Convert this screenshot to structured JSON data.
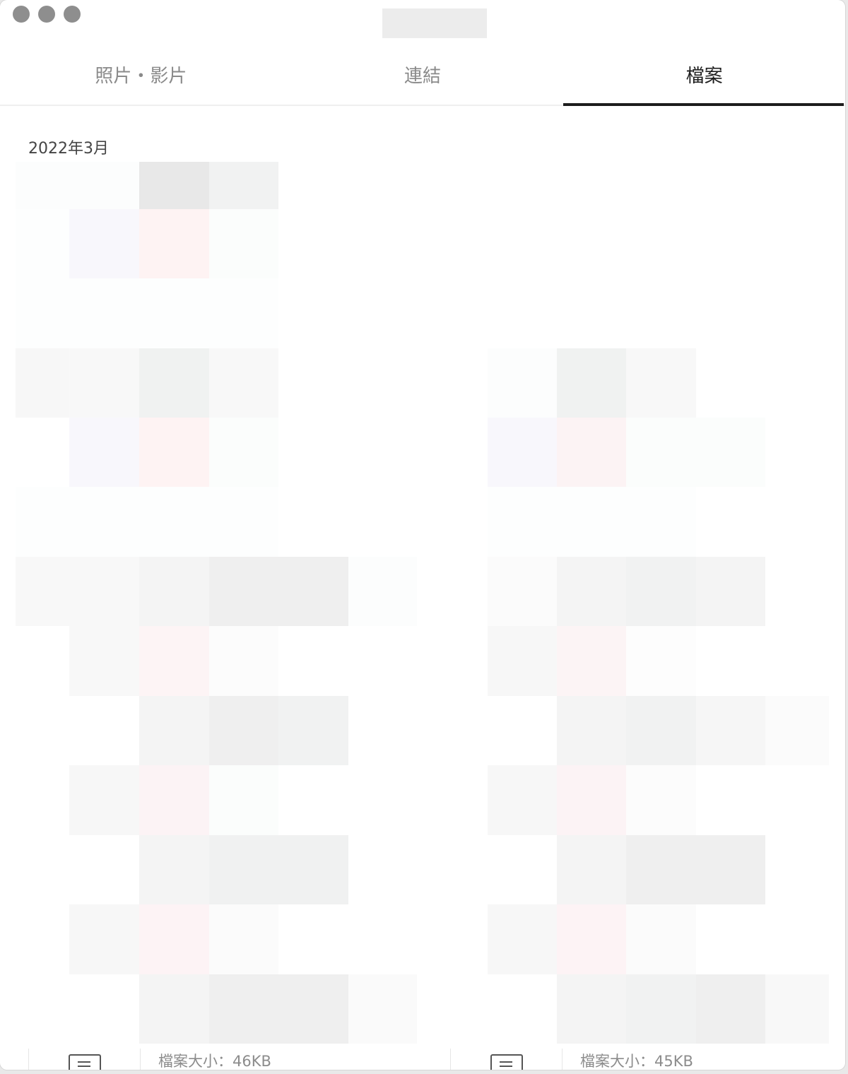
{
  "tabs": [
    {
      "label": "照片・影片",
      "active": false
    },
    {
      "label": "連結",
      "active": false
    },
    {
      "label": "檔案",
      "active": true
    }
  ],
  "section": {
    "date": "2022年3月"
  },
  "files": [
    {
      "size_label": "檔案大小：46KB"
    },
    {
      "size_label": "檔案大小：45KB"
    }
  ],
  "colors": {
    "accent": "#1d1d1d",
    "inactive_tab": "#8a8a8a"
  }
}
